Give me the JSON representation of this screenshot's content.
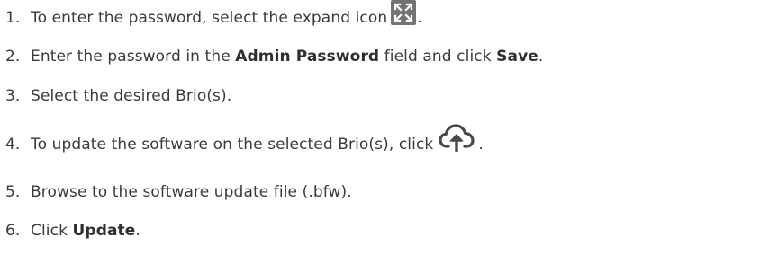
{
  "steps": [
    {
      "number": "1.",
      "parts": {
        "a": "To enter the password, select the expand icon",
        "icon": "expand-icon",
        "b": "."
      }
    },
    {
      "number": "2.",
      "parts": {
        "a": "Enter the password in the ",
        "bold1": "Admin Password",
        "b": " field and click ",
        "bold2": "Save",
        "c": "."
      }
    },
    {
      "number": "3.",
      "parts": {
        "a": "Select the desired Brio(s)."
      }
    },
    {
      "number": "4.",
      "parts": {
        "a": "To update the software on the selected Brio(s), click",
        "icon": "cloud-upload-icon",
        "b": "."
      }
    },
    {
      "number": "5.",
      "parts": {
        "a": "Browse to the software update file (.bfw)."
      }
    },
    {
      "number": "6.",
      "parts": {
        "a": "Click ",
        "bold1": "Update",
        "b": "."
      }
    }
  ],
  "colors": {
    "text": "#3a3a3a",
    "expand_icon_bg": "#737373",
    "icon_fg": "#ffffff",
    "cloud_icon": "#4a4a4a"
  }
}
